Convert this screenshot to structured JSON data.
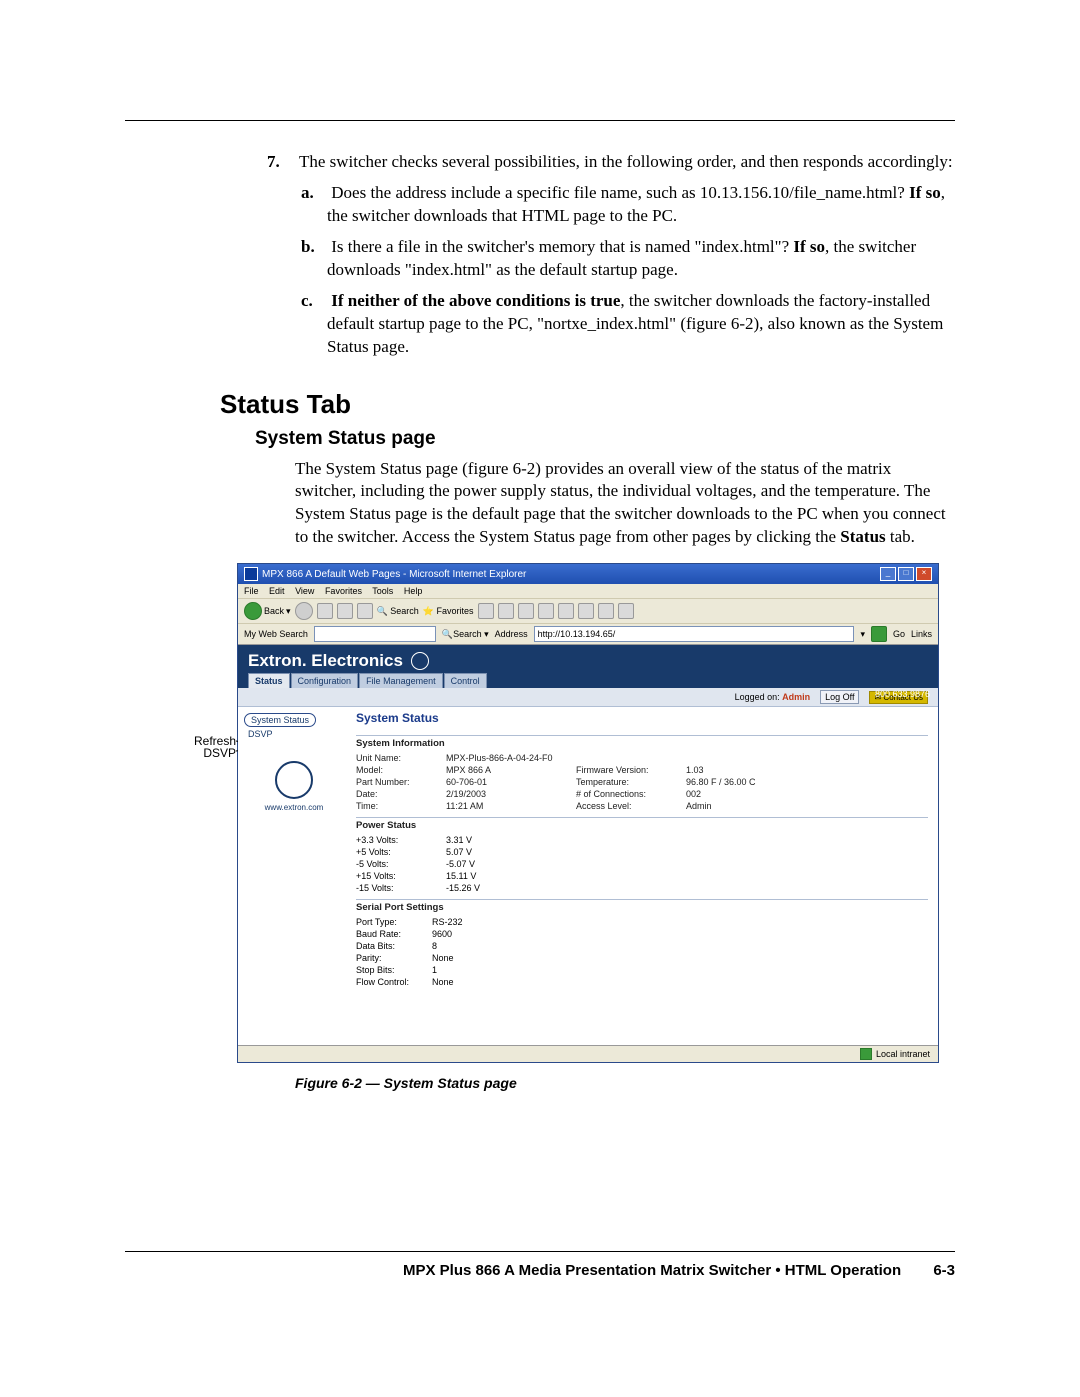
{
  "step7": {
    "num": "7.",
    "text": "The switcher checks several possibilities, in the following order, and then responds accordingly:",
    "a_letter": "a.",
    "a_text1": "Does the address include a specific file name, such as 10.13.156.10/file_name.html?  ",
    "a_bold": "If so",
    "a_text2": ", the switcher downloads that HTML page to the PC.",
    "b_letter": "b.",
    "b_text1": "Is there a file in the switcher's memory that is named \"index.html\"?  ",
    "b_bold": "If so",
    "b_text2": ", the switcher downloads \"index.html\" as the default startup page.",
    "c_letter": "c.",
    "c_bold": "If neither of the above conditions is true",
    "c_text": ", the switcher downloads the factory-installed default startup page to the PC, \"nortxe_index.html\" (figure 6-2), also known as the System Status page."
  },
  "headings": {
    "status_tab": "Status Tab",
    "system_status": "System Status page"
  },
  "para": "The System Status page (figure 6-2) provides an overall view of the status of the matrix switcher, including the power supply status, the individual voltages, and the temperature.  The System Status page is the default page that the switcher downloads to the PC when you connect to the switcher.  Access the System Status page from other pages by clicking the ",
  "para_bold": "Status",
  "para_tail": " tab.",
  "annot": {
    "refresh": "Refresh",
    "dsvp": "DSVP"
  },
  "ie": {
    "title": "MPX 866 A Default Web Pages - Microsoft Internet Explorer",
    "menu": {
      "file": "File",
      "edit": "Edit",
      "view": "View",
      "favorites": "Favorites",
      "tools": "Tools",
      "help": "Help"
    },
    "toolbar": {
      "back": "Back",
      "search": "Search",
      "favorites": "Favorites"
    },
    "addr": {
      "label": "My Web Search",
      "search_btn": "Search",
      "addr_label": "Address",
      "url": "http://10.13.194.65/",
      "go": "Go",
      "links": "Links"
    },
    "brand": "Extron. Electronics",
    "phone": "800.633.9876",
    "tabs": {
      "status": "Status",
      "config": "Configuration",
      "file": "File Management",
      "control": "Control"
    },
    "login": {
      "logged": "Logged on:",
      "user": "Admin",
      "logoff": "Log Off",
      "contact": "Contact Us"
    },
    "sidebar": {
      "sys": "System Status",
      "dsvp": "DSVP",
      "url": "www.extron.com"
    },
    "panel_title": "System Status",
    "sys_info": {
      "head": "System Information",
      "unit_l": "Unit Name:",
      "unit_v": "MPX-Plus-866-A-04-24-F0",
      "model_l": "Model:",
      "model_v": "MPX 866 A",
      "part_l": "Part Number:",
      "part_v": "60-706-01",
      "date_l": "Date:",
      "date_v": "2/19/2003",
      "time_l": "Time:",
      "time_v": "11:21 AM",
      "fw_l": "Firmware Version:",
      "fw_v": "1.03",
      "temp_l": "Temperature:",
      "temp_v": "96.80 F / 36.00 C",
      "conn_l": "# of Connections:",
      "conn_v": "002",
      "acc_l": "Access Level:",
      "acc_v": "Admin"
    },
    "power": {
      "head": "Power Status",
      "r1l": "+3.3 Volts:",
      "r1v": "3.31 V",
      "r2l": "+5 Volts:",
      "r2v": "5.07 V",
      "r3l": "-5 Volts:",
      "r3v": "-5.07 V",
      "r4l": "+15 Volts:",
      "r4v": "15.11 V",
      "r5l": "-15 Volts:",
      "r5v": "-15.26 V"
    },
    "serial": {
      "head": "Serial Port Settings",
      "pt_l": "Port Type:",
      "pt_v": "RS-232",
      "br_l": "Baud Rate:",
      "br_v": "9600",
      "db_l": "Data Bits:",
      "db_v": "8",
      "pa_l": "Parity:",
      "pa_v": "None",
      "sb_l": "Stop Bits:",
      "sb_v": "1",
      "fc_l": "Flow Control:",
      "fc_v": "None"
    },
    "status_text": "Local intranet"
  },
  "caption": "Figure 6-2 — System Status page",
  "footer": {
    "text": "MPX Plus 866 A Media Presentation Matrix Switcher • HTML Operation",
    "page": "6-3"
  }
}
